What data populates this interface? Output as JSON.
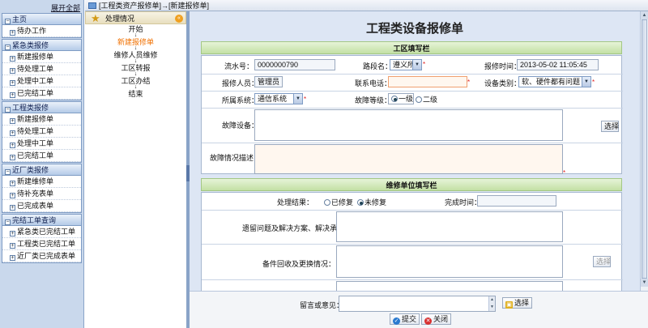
{
  "sidebar": {
    "expand_all": "展开全部",
    "groups": [
      {
        "title": "主页",
        "items": [
          "待办工作"
        ]
      },
      {
        "title": "紧急类报修",
        "items": [
          "新建报修单",
          "待处理工单",
          "处理中工单",
          "已完结工单"
        ]
      },
      {
        "title": "工程类报修",
        "items": [
          "新建报修单",
          "待处理工单",
          "处理中工单",
          "已完结工单"
        ]
      },
      {
        "title": "近厂类报修",
        "items": [
          "新建维修单",
          "待补充表单",
          "已完成表单"
        ]
      },
      {
        "title": "完结工单查询",
        "items": [
          "紧急类已完结工单",
          "工程类已完结工单",
          "近厂类已完成表单"
        ]
      }
    ]
  },
  "breadcrumb": "[工程类资产报修单]→[新建报修单]",
  "flow": {
    "header": "处理情况",
    "steps": [
      "开始",
      "新建报修单",
      "维修人员维修",
      "工区转报",
      "工区办结",
      "结束"
    ],
    "current": 1
  },
  "form": {
    "title": "工程类设备报修单",
    "section1": "工区填写栏",
    "serial_label": "流水号：",
    "serial_value": "0000000790",
    "road_label": "路段名：",
    "road_value": "遵义所",
    "report_time_label": "报修时间：",
    "report_time_value": "2013-05-02 11:05:45",
    "reporter_label": "报修人员：",
    "reporter_value": "管理员",
    "phone_label": "联系电话：",
    "phone_value": "",
    "category_label": "设备类别：",
    "category_value": "软、硬件都有问题",
    "system_label": "所属系统：",
    "system_value": "通信系统",
    "level_label": "故障等级：",
    "level_options": [
      "一级",
      "二级"
    ],
    "device_label": "故障设备：",
    "select_label": "选择",
    "desc_label": "故障情况描述：",
    "section2": "维修单位填写栏",
    "result_label": "处理结果：",
    "result_options": [
      "已修复",
      "未修复"
    ],
    "finish_time_label": "完成时间：",
    "issue_label": "遗留问题及解决方案、解决承诺：",
    "parts_label": "备件回收及更换情况：",
    "parts_select_label": "选择"
  },
  "footer": {
    "comment_label": "留言或意见：",
    "select_label": "选择",
    "submit_label": "提交",
    "close_label": "关闭"
  }
}
